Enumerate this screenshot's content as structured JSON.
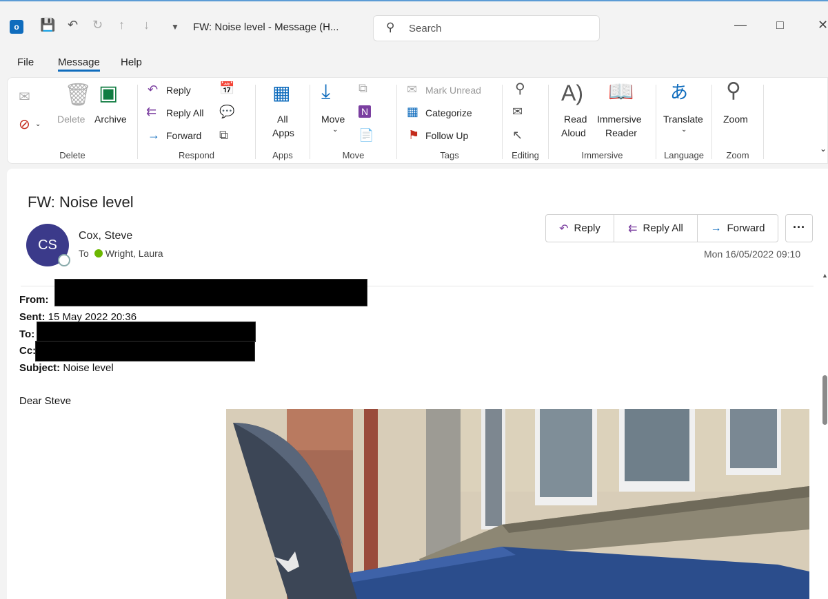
{
  "titlebar": {
    "title": "FW: Noise level  -  Message (H...",
    "search_placeholder": "Search"
  },
  "menu": [
    "File",
    "Message",
    "Help"
  ],
  "ribbon": {
    "delete_group": {
      "label": "Delete",
      "delete": "Delete",
      "archive": "Archive"
    },
    "respond_group": {
      "label": "Respond",
      "reply": "Reply",
      "reply_all": "Reply All",
      "forward": "Forward"
    },
    "apps_group": {
      "label": "Apps",
      "all_apps_line1": "All",
      "all_apps_line2": "Apps"
    },
    "move_group": {
      "label": "Move",
      "move": "Move"
    },
    "tags_group": {
      "label": "Tags",
      "mark_unread": "Mark Unread",
      "categorize": "Categorize",
      "follow_up": "Follow Up"
    },
    "editing_group": {
      "label": "Editing"
    },
    "immersive_group": {
      "label": "Immersive",
      "read_aloud_1": "Read",
      "read_aloud_2": "Aloud",
      "reader_1": "Immersive",
      "reader_2": "Reader"
    },
    "language_group": {
      "label": "Language",
      "translate": "Translate"
    },
    "zoom_group": {
      "label": "Zoom",
      "zoom": "Zoom"
    }
  },
  "message": {
    "subject": "FW: Noise level",
    "avatar_initials": "CS",
    "sender": "Cox, Steve",
    "to_prefix": "To",
    "recipient": "Wright, Laura",
    "date": "Mon 16/05/2022 09:10",
    "actions": {
      "reply": "Reply",
      "reply_all": "Reply All",
      "forward": "Forward",
      "more": "···"
    }
  },
  "forwarded": {
    "from_label": "From:",
    "sent_label": "Sent:",
    "sent_value": "15 May 2022 20:36",
    "to_label": "To:",
    "cc_label": "Cc:",
    "subject_label": "Subject:",
    "subject_value": "Noise level",
    "greeting": "Dear Steve"
  },
  "colors": {
    "accent": "#0f6cbd",
    "avatar": "#3b3a8a",
    "respond_icon": "#7b3fa0",
    "presence_available": "#6bb700"
  }
}
